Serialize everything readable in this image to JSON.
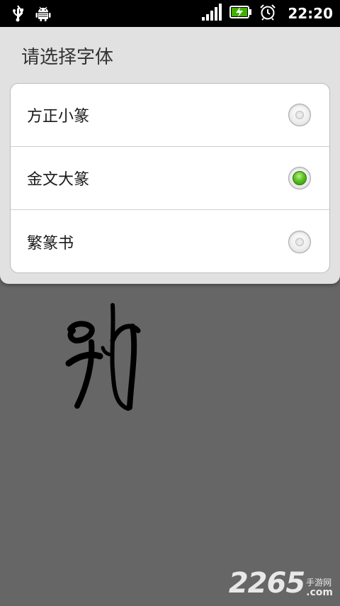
{
  "status_bar": {
    "time": "22:20",
    "icons": [
      "usb-icon",
      "android-debug-icon",
      "signal-icon",
      "battery-charging-icon",
      "alarm-icon"
    ]
  },
  "dialog": {
    "title": "请选择字体",
    "options": [
      {
        "label": "方正小篆",
        "selected": false
      },
      {
        "label": "金文大篆",
        "selected": true
      },
      {
        "label": "繁篆书",
        "selected": false
      }
    ]
  },
  "watermark": {
    "number": "2265",
    "suffix_cn": "手游网",
    "suffix_com": ".com"
  },
  "colors": {
    "status_bar_bg": "#000000",
    "dialog_bg": "#e1e1e1",
    "page_bg": "#666666",
    "radio_selected": "#4fb81b"
  }
}
